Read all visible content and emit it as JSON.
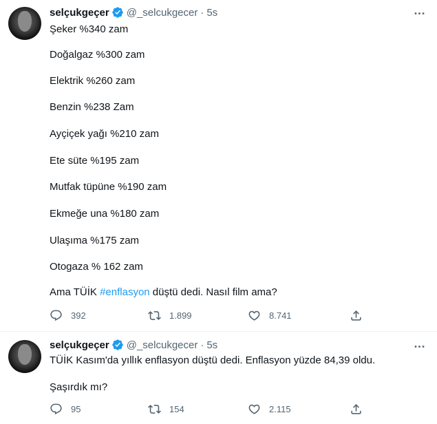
{
  "tweets": [
    {
      "author": {
        "name": "selçukgeçer",
        "handle": "@_selcukgecer",
        "time": "5s",
        "verified": true
      },
      "text": {
        "lines": [
          "Şeker  %340 zam",
          "Doğalgaz %300 zam",
          "Elektrik   %260  zam",
          "Benzin   %238 Zam",
          "Ayçiçek yağı %210 zam",
          "Ete süte %195 zam",
          "Mutfak tüpüne %190 zam",
          "Ekmeğe una %180 zam",
          "Ulaşıma %175 zam",
          "Otogaza % 162 zam"
        ],
        "last_line": {
          "before": "Ama TÜİK ",
          "hashtag": "#enflasyon",
          "after": " düştü dedi. Nasıl film ama?"
        }
      },
      "stats": {
        "replies": "392",
        "retweets": "1.899",
        "likes": "8.741"
      }
    },
    {
      "author": {
        "name": "selçukgeçer",
        "handle": "@_selcukgecer",
        "time": "5s",
        "verified": true
      },
      "text": {
        "lines": [
          "TÜİK Kasım'da yıllık enflasyon düştü dedi. Enflasyon yüzde 84,39 oldu.",
          "Şaşırdık mı?"
        ]
      },
      "stats": {
        "replies": "95",
        "retweets": "154",
        "likes": "2.115"
      }
    }
  ],
  "colors": {
    "accent": "#1d9bf0",
    "text": "#0f1419",
    "secondary": "#536471"
  },
  "icons": [
    "verified-badge-icon",
    "more-icon",
    "reply-icon",
    "retweet-icon",
    "like-icon",
    "share-icon"
  ]
}
